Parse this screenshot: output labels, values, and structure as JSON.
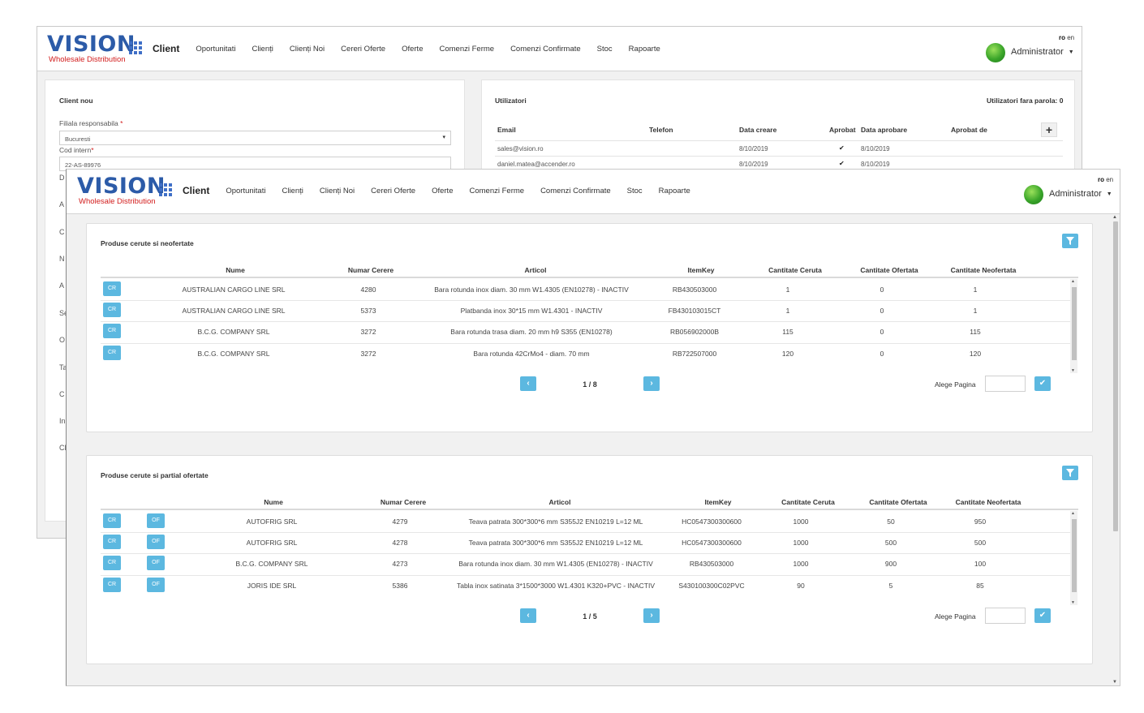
{
  "brand": {
    "logo_text": "VISION",
    "logo_subtitle": "Wholesale Distribution",
    "active_section": "Client"
  },
  "nav_items": [
    "Oportunitati",
    "Clienți",
    "Clienți Noi",
    "Cereri Oferte",
    "Oferte",
    "Comenzi Ferme",
    "Comenzi Confirmate",
    "Stoc",
    "Rapoarte"
  ],
  "language": {
    "active": "ro",
    "other": "en"
  },
  "user": {
    "name": "Administrator"
  },
  "back_window": {
    "client_panel": {
      "title": "Client nou",
      "filiala_label": "Filiala responsabila",
      "filiala_value": "Bucuresti",
      "cod_intern_label": "Cod intern",
      "cod_intern_value": "22-AS-89976",
      "side_letters": [
        "D",
        "A",
        "C",
        "N",
        "A",
        "Se",
        "O",
        "Ta",
        "C",
        "In",
        "Cl"
      ]
    },
    "users_panel": {
      "title": "Utilizatori",
      "no_password_text": "Utilizatori fara parola: 0",
      "columns": [
        "Email",
        "Telefon",
        "Data creare",
        "Aprobat",
        "Data aprobare",
        "Aprobat de"
      ],
      "add_label": "+",
      "rows": [
        {
          "email": "sales@vision.ro",
          "telefon": "",
          "data_creare": "8/10/2019",
          "aprobat": "✔",
          "data_aprobare": "8/10/2019",
          "aprobat_de": ""
        },
        {
          "email": "daniel.matea@accender.ro",
          "telefon": "",
          "data_creare": "8/10/2019",
          "aprobat": "✔",
          "data_aprobare": "8/10/2019",
          "aprobat_de": ""
        }
      ]
    }
  },
  "table1": {
    "title": "Produse cerute si neofertate",
    "columns": [
      "Nume",
      "Numar Cerere",
      "Articol",
      "ItemKey",
      "Cantitate Ceruta",
      "Cantitate Ofertata",
      "Cantitate Neofertata"
    ],
    "rows": [
      {
        "btn": "CR",
        "nume": "AUSTRALIAN CARGO LINE SRL",
        "numar": "4280",
        "articol": "Bara rotunda inox diam. 30 mm W1.4305 (EN10278) - INACTIV",
        "itemkey": "RB430503000",
        "ceruta": "1",
        "ofertata": "0",
        "neofertata": "1"
      },
      {
        "btn": "CR",
        "nume": "AUSTRALIAN CARGO LINE SRL",
        "numar": "5373",
        "articol": "Platbanda inox 30*15 mm W1.4301 - INACTIV",
        "itemkey": "FB430103015CT",
        "ceruta": "1",
        "ofertata": "0",
        "neofertata": "1"
      },
      {
        "btn": "CR",
        "nume": "B.C.G. COMPANY SRL",
        "numar": "3272",
        "articol": "Bara rotunda trasa diam. 20 mm h9 S355 (EN10278)",
        "itemkey": "RB056902000B",
        "ceruta": "115",
        "ofertata": "0",
        "neofertata": "115"
      },
      {
        "btn": "CR",
        "nume": "B.C.G. COMPANY SRL",
        "numar": "3272",
        "articol": "Bara rotunda 42CrMo4 - diam. 70 mm",
        "itemkey": "RB722507000",
        "ceruta": "120",
        "ofertata": "0",
        "neofertata": "120"
      }
    ],
    "page_indicator": "1 / 8",
    "goto_label": "Alege Pagina"
  },
  "table2": {
    "title": "Produse cerute si partial ofertate",
    "columns": [
      "Nume",
      "Numar Cerere",
      "Articol",
      "ItemKey",
      "Cantitate Ceruta",
      "Cantitate Ofertata",
      "Cantitate Neofertata"
    ],
    "rows": [
      {
        "btn1": "CR",
        "btn2": "OF",
        "nume": "AUTOFRIG SRL",
        "numar": "4279",
        "articol": "Teava patrata 300*300*6 mm S355J2 EN10219 L=12 ML",
        "itemkey": "HC0547300300600",
        "ceruta": "1000",
        "ofertata": "50",
        "neofertata": "950"
      },
      {
        "btn1": "CR",
        "btn2": "OF",
        "nume": "AUTOFRIG SRL",
        "numar": "4278",
        "articol": "Teava patrata 300*300*6 mm S355J2 EN10219 L=12 ML",
        "itemkey": "HC0547300300600",
        "ceruta": "1000",
        "ofertata": "500",
        "neofertata": "500"
      },
      {
        "btn1": "CR",
        "btn2": "OF",
        "nume": "B.C.G. COMPANY SRL",
        "numar": "4273",
        "articol": "Bara rotunda inox diam. 30 mm W1.4305 (EN10278) - INACTIV",
        "itemkey": "RB430503000",
        "ceruta": "1000",
        "ofertata": "900",
        "neofertata": "100"
      },
      {
        "btn1": "CR",
        "btn2": "OF",
        "nume": "JORIS IDE SRL",
        "numar": "5386",
        "articol": "Tabla inox satinata 3*1500*3000 W1.4301 K320+PVC - INACTIV",
        "itemkey": "S430100300C02PVC",
        "ceruta": "90",
        "ofertata": "5",
        "neofertata": "85"
      }
    ],
    "page_indicator": "1 / 5",
    "goto_label": "Alege Pagina"
  },
  "colors": {
    "accent": "#5cb8e0",
    "brand_blue": "#2c5ba8",
    "brand_red": "#d21c1c"
  },
  "icons": {
    "menu": "grid-icon",
    "filter": "filter-icon",
    "prev": "chevron-left-icon",
    "next": "chevron-right-icon",
    "confirm": "check-icon",
    "add": "plus-icon"
  }
}
